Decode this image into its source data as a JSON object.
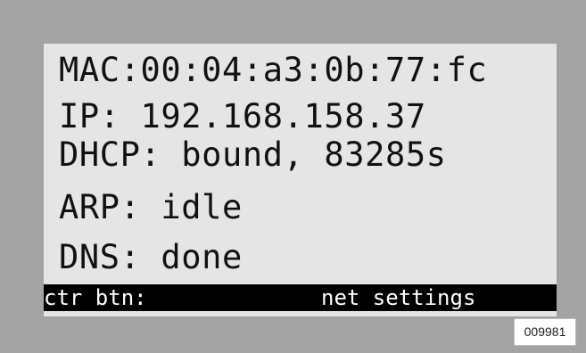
{
  "display": {
    "lines": [
      "MAC:00:04:a3:0b:77:fc",
      "IP: 192.168.158.37",
      "DHCP: bound, 83285s",
      "ARP: idle",
      "DNS: done"
    ],
    "status_bar": {
      "left": "ctr btn:",
      "right": "net settings"
    }
  },
  "figure_id": "009981",
  "colors": {
    "outer_frame": "#a3a3a3",
    "screen_background": "#e5e5e5",
    "screen_text": "#111111",
    "status_bar_background": "#000000",
    "status_bar_text": "#ffffff"
  }
}
